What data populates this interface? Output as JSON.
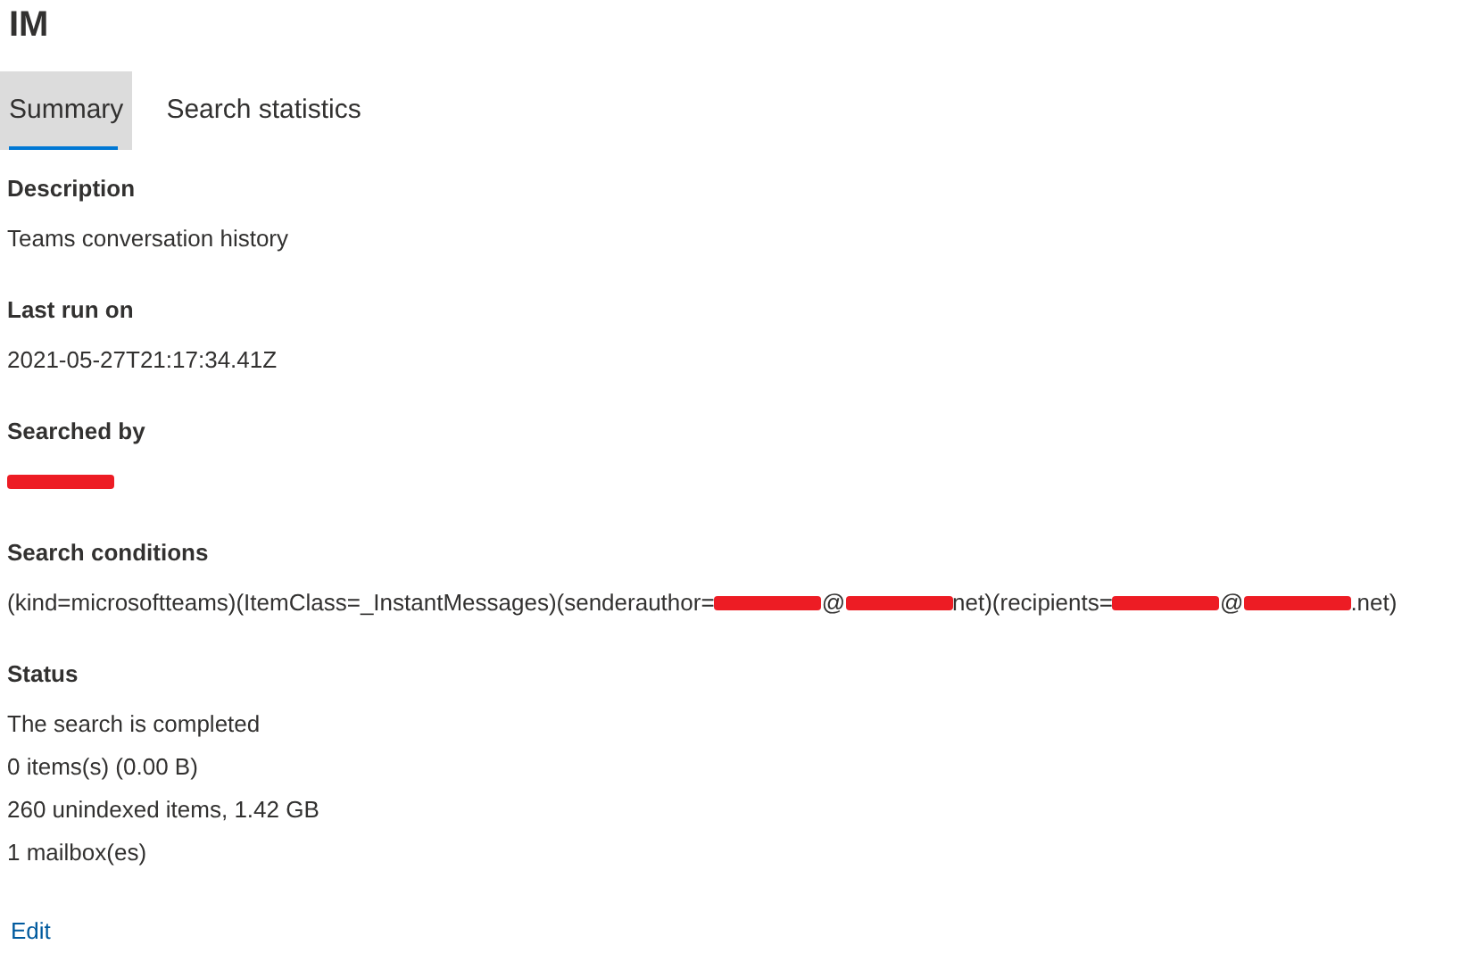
{
  "title": "IM",
  "tabs": [
    {
      "label": "Summary",
      "selected": true
    },
    {
      "label": "Search statistics",
      "selected": false
    }
  ],
  "sections": [
    {
      "label": "Description",
      "lines": [
        [
          {
            "kind": "text",
            "text": "Teams conversation history"
          }
        ]
      ]
    },
    {
      "label": "Last run on",
      "lines": [
        [
          {
            "kind": "text",
            "text": "2021-05-27T21:17:34.41Z"
          }
        ]
      ]
    },
    {
      "label": "Searched by",
      "lines": [
        [
          {
            "kind": "redacted"
          }
        ]
      ]
    },
    {
      "label": "Search conditions",
      "lines": [
        [
          {
            "kind": "text",
            "text": "(kind=microsoftteams)(ItemClass=_InstantMessages)(senderauthor="
          },
          {
            "kind": "redacted"
          },
          {
            "kind": "text",
            "text": "@"
          },
          {
            "kind": "redacted"
          },
          {
            "kind": "text",
            "text": "net)(recipients="
          },
          {
            "kind": "redacted"
          },
          {
            "kind": "text",
            "text": "@"
          },
          {
            "kind": "redacted"
          },
          {
            "kind": "text",
            "text": ".net)"
          }
        ]
      ]
    },
    {
      "label": "Status",
      "lines": [
        [
          {
            "kind": "text",
            "text": "The search is completed"
          }
        ],
        [
          {
            "kind": "text",
            "text": "0 items(s) (0.00 B)"
          }
        ],
        [
          {
            "kind": "text",
            "text": "260 unindexed items, 1.42 GB"
          }
        ],
        [
          {
            "kind": "text",
            "text": "1 mailbox(es)"
          }
        ]
      ]
    }
  ],
  "edit_link": "Edit"
}
